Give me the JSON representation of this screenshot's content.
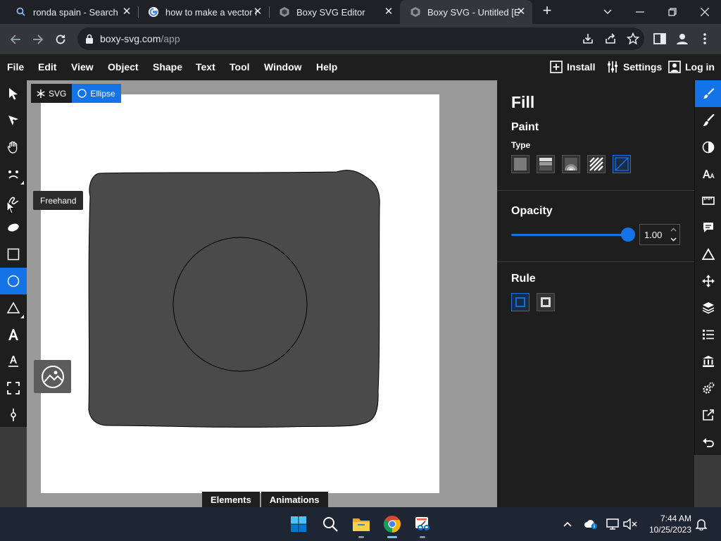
{
  "browser": {
    "tabs": [
      {
        "title": "ronda spain - Search"
      },
      {
        "title": "how to make a vector i"
      },
      {
        "title": "Boxy SVG Editor"
      },
      {
        "title": "Boxy SVG - Untitled [E"
      }
    ],
    "close_glyph": "✕",
    "new_tab_glyph": "+",
    "url_host": "boxy-svg.com",
    "url_path": "/app"
  },
  "menubar": {
    "items": [
      "File",
      "Edit",
      "View",
      "Object",
      "Shape",
      "Text",
      "Tool",
      "Window",
      "Help"
    ],
    "install": "Install",
    "settings": "Settings",
    "login": "Log in"
  },
  "canvas": {
    "breadcrumb_svg": "SVG",
    "breadcrumb_ellipse": "Ellipse",
    "tooltip": "Freehand",
    "bottom_tabs": [
      "Elements",
      "Animations"
    ],
    "shape_fill": "#4a4a4a",
    "accent": "#1473e6"
  },
  "panel": {
    "title": "Fill",
    "paint_heading": "Paint",
    "type_label": "Type",
    "opacity_heading": "Opacity",
    "opacity_value": "1.00",
    "opacity_level": 1.0,
    "rule_heading": "Rule"
  },
  "taskbar": {
    "time": "7:44 AM",
    "date": "10/25/2023"
  }
}
